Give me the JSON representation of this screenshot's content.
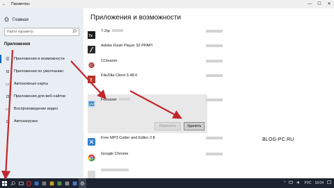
{
  "window": {
    "title": "Параметры",
    "back_glyph": "←",
    "controls": [
      "—",
      "☐",
      "✕"
    ]
  },
  "sidebar": {
    "home": "Главная",
    "search_placeholder": "Найти параметр",
    "section": "Приложения",
    "items": [
      {
        "label": "Приложения и возможности",
        "icon": "list-icon",
        "glyph": "☰",
        "active": true
      },
      {
        "label": "Приложения по умолчанию",
        "icon": "default-apps-icon",
        "glyph": "⊟",
        "active": false
      },
      {
        "label": "Автономные карты",
        "icon": "map-icon",
        "glyph": "▭",
        "active": false
      },
      {
        "label": "Приложения для веб-сайтов",
        "icon": "web-icon",
        "glyph": "⊡",
        "active": false
      },
      {
        "label": "Воспроизведение видео",
        "icon": "video-icon",
        "glyph": "▭",
        "active": false
      },
      {
        "label": "Автозагрузка",
        "icon": "startup-icon",
        "glyph": "⊏",
        "active": false
      }
    ]
  },
  "content": {
    "heading": "Приложения и возможности",
    "apps": [
      {
        "name": "7-Zip",
        "icon": "7zip-icon",
        "color": "#1b1b1b"
      },
      {
        "name": "Adobe Flash Player 32 PPAPI",
        "icon": "flash-icon",
        "color": "#2a2a2a"
      },
      {
        "name": "CCleaner",
        "icon": "ccleaner-icon",
        "color": "#b0403a"
      },
      {
        "name": "FileZilla Client 3.48.0",
        "icon": "filezilla-icon",
        "color": "#b8352a"
      },
      {
        "name": "Fotosizer",
        "icon": "fotosizer-icon",
        "color": "#4a8ec4"
      },
      {
        "name": "Free MP3 Cutter and Editor 2.8",
        "icon": "mp3cutter-icon",
        "color": "#2f7fd0"
      },
      {
        "name": "Google Chrome",
        "icon": "chrome-icon",
        "color": "#d44638"
      }
    ],
    "modify_button": "Изменить",
    "uninstall_button": "Удалить"
  },
  "watermark": "BLOG-PC.RU",
  "taskbar": {
    "language": "РУС",
    "time": "16:04"
  },
  "colors": {
    "accent": "#0067c0",
    "annotation_arrow": "#c0262b"
  }
}
